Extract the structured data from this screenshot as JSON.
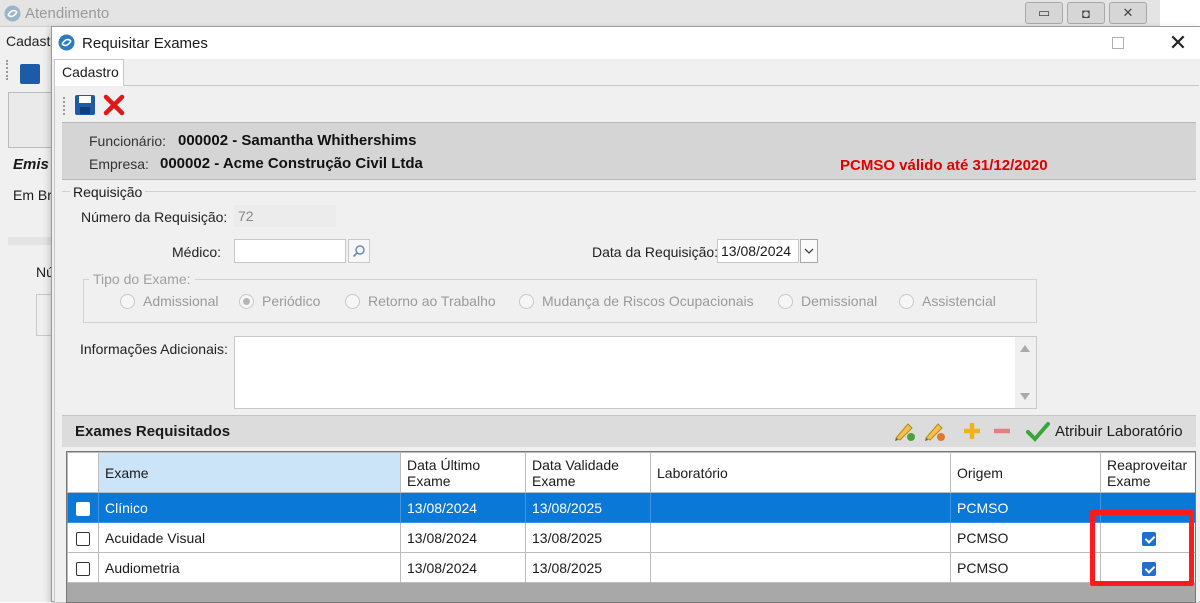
{
  "background_window": {
    "title": "Atendimento",
    "menu_partial": "Cadastr",
    "emis_partial": "Emis",
    "em_br_partial": "Em Br",
    "nu_partial": "Nú"
  },
  "dialog": {
    "title": "Requisitar Exames",
    "tab": "Cadastro"
  },
  "header": {
    "funcionario_label": "Funcionário:",
    "funcionario_value": "000002 - Samantha Whithershims",
    "empresa_label": "Empresa:",
    "empresa_value": "000002 - Acme Construção Civil Ltda",
    "alert": "PCMSO válido até 31/12/2020"
  },
  "requisicao": {
    "legend": "Requisição",
    "numero_label": "Número da Requisição:",
    "numero_value": "72",
    "medico_label": "Médico:",
    "medico_value": "",
    "data_label": "Data da Requisição:",
    "data_value": "13/08/2024",
    "tipo_legend": "Tipo do Exame:",
    "tipos": [
      "Admissional",
      "Periódico",
      "Retorno ao Trabalho",
      "Mudança de Riscos Ocupacionais",
      "Demissional",
      "Assistencial"
    ],
    "tipo_selected": "Periódico",
    "info_label": "Informações Adicionais:",
    "info_value": ""
  },
  "exames": {
    "title": "Exames Requisitados",
    "atribuir_label": "Atribuir Laboratório",
    "columns": {
      "exame": "Exame",
      "data_ultimo_1": "Data Último",
      "data_ultimo_2": "Exame",
      "data_validade_1": "Data Validade",
      "data_validade_2": "Exame",
      "laboratorio": "Laboratório",
      "origem": "Origem",
      "reaproveitar_1": "Reaproveitar",
      "reaproveitar_2": "Exame"
    },
    "rows": [
      {
        "exame": "Clínico",
        "data_ultimo": "13/08/2024",
        "data_validade": "13/08/2025",
        "laboratorio": "",
        "origem": "PCMSO",
        "reaproveitar": false,
        "selected": true
      },
      {
        "exame": "Acuidade Visual",
        "data_ultimo": "13/08/2024",
        "data_validade": "13/08/2025",
        "laboratorio": "",
        "origem": "PCMSO",
        "reaproveitar": true,
        "selected": false
      },
      {
        "exame": "Audiometria",
        "data_ultimo": "13/08/2024",
        "data_validade": "13/08/2025",
        "laboratorio": "",
        "origem": "PCMSO",
        "reaproveitar": true,
        "selected": false
      }
    ]
  },
  "colors": {
    "alert": "#e00000",
    "selection": "#0a78d7",
    "highlight": "#ff1b1b",
    "checkbox": "#1f6fd1"
  },
  "icons": [
    "app-logo-icon",
    "save-icon",
    "delete-icon",
    "search-icon",
    "dropdown-icon",
    "edit-icon",
    "add-icon",
    "remove-icon",
    "checkmark-icon",
    "close-icon",
    "maximize-icon",
    "minimize-icon",
    "restore-icon"
  ]
}
